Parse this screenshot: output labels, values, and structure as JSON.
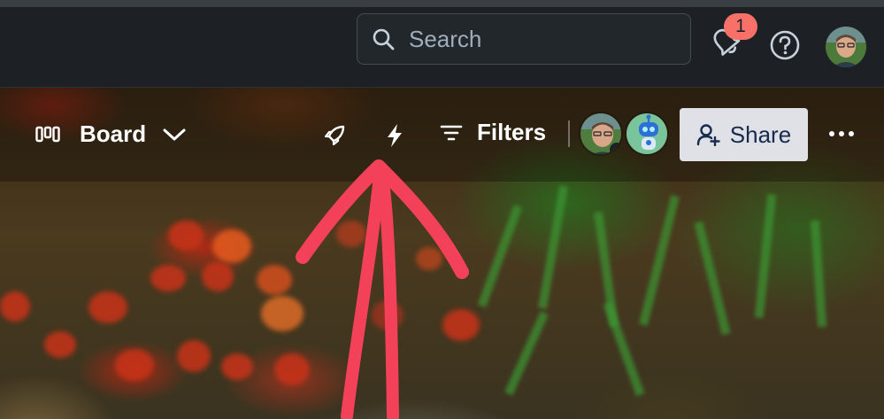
{
  "topbar": {
    "search_placeholder": "Search",
    "notifications_count": "1",
    "icons": [
      "search-icon",
      "notification-bell-icon",
      "help-icon",
      "user-avatar"
    ]
  },
  "board_header": {
    "view_label": "Board",
    "filters_label": "Filters",
    "share_label": "Share",
    "icons": [
      "board-view-icon",
      "chevron-down-icon",
      "power-ups-rocket-icon",
      "automation-bolt-icon",
      "filter-icon",
      "more-icon"
    ]
  },
  "colors": {
    "app_bg": "#1d2125",
    "badge": "#f87168",
    "share_bg": "#dfe1e6",
    "annotation_arrow": "#f4415a"
  }
}
